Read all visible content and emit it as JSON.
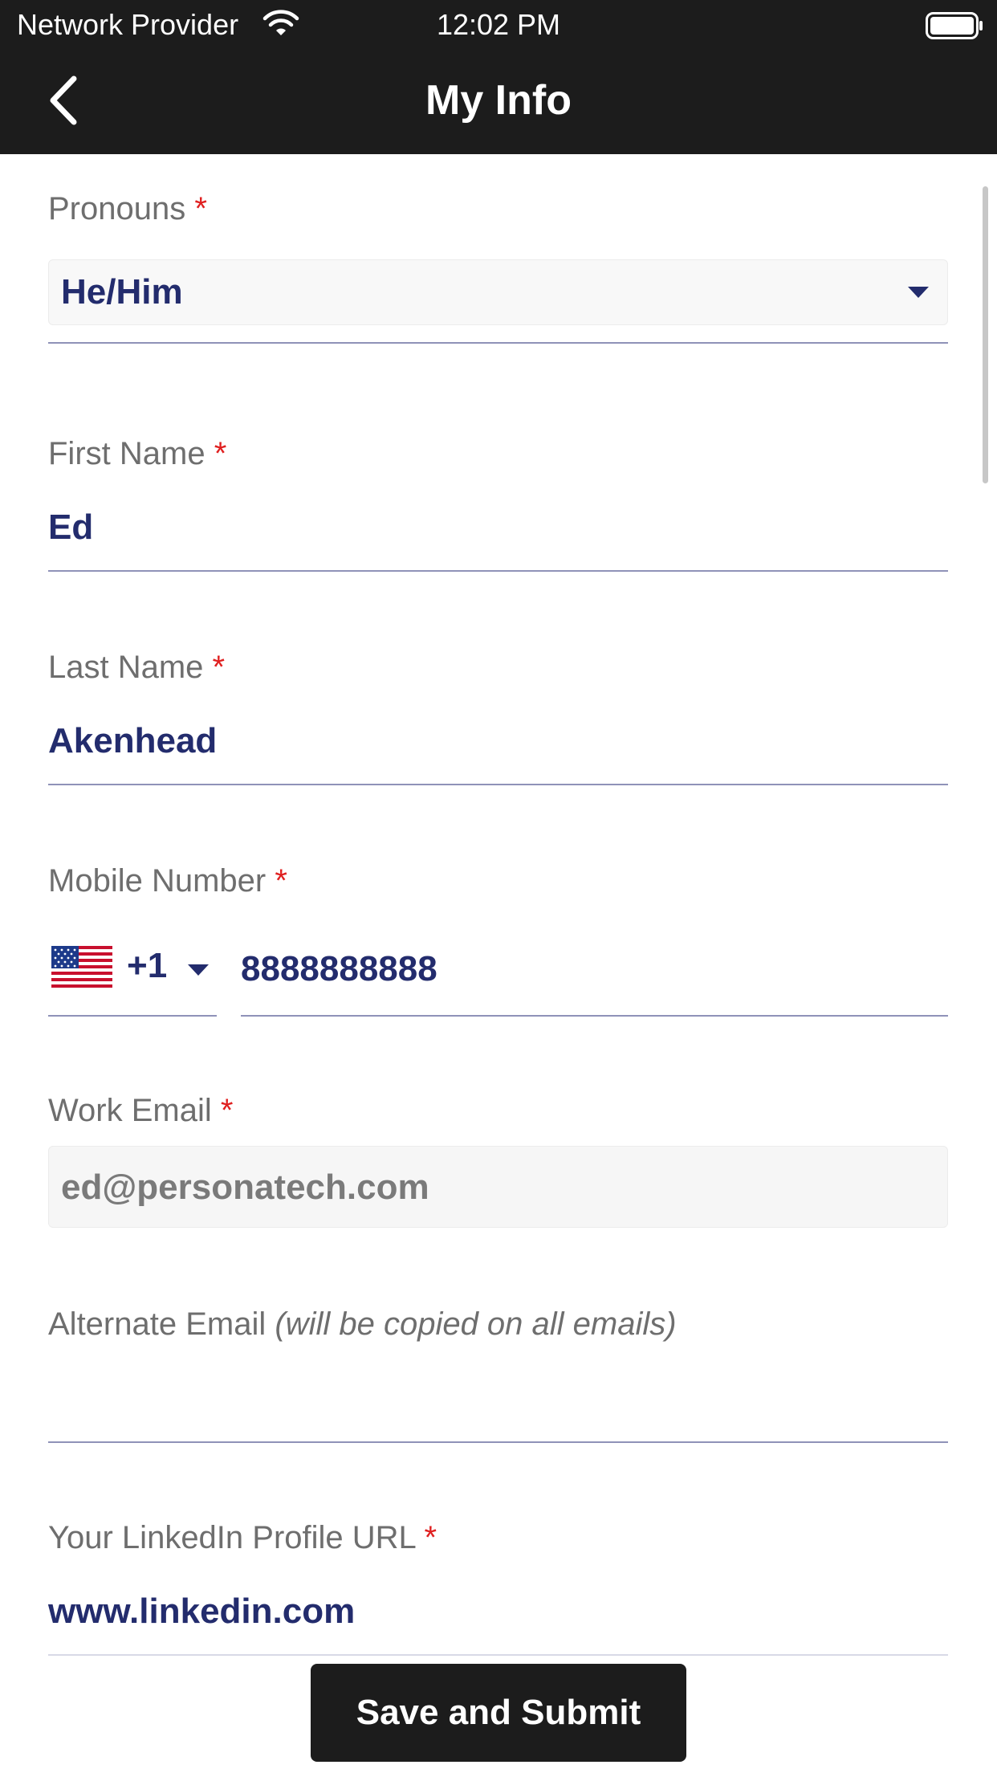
{
  "status_bar": {
    "carrier": "Network Provider",
    "time": "12:02 PM"
  },
  "nav": {
    "title": "My Info"
  },
  "form": {
    "pronouns": {
      "label": "Pronouns",
      "required_mark": "*",
      "value": "He/Him"
    },
    "first_name": {
      "label": "First Name",
      "required_mark": "*",
      "value": "Ed"
    },
    "last_name": {
      "label": "Last Name",
      "required_mark": "*",
      "value": "Akenhead"
    },
    "mobile": {
      "label": "Mobile Number",
      "required_mark": "*",
      "country_code": "+1",
      "country_flag": "us-flag-icon",
      "value": "8888888888"
    },
    "work_email": {
      "label": "Work Email",
      "required_mark": "*",
      "value": "ed@personatech.com"
    },
    "alternate_email": {
      "label": "Alternate Email",
      "hint": "(will be copied on all emails)",
      "value": ""
    },
    "linkedin": {
      "label": "Your LinkedIn Profile URL",
      "required_mark": "*",
      "value": "www.linkedin.com"
    }
  },
  "actions": {
    "submit_label": "Save and Submit"
  },
  "colors": {
    "bar_background": "#1c1c1c",
    "value_text": "#232c6d",
    "label_text": "#6e6e6e",
    "required": "#e02020",
    "underline": "#8f92b8"
  }
}
